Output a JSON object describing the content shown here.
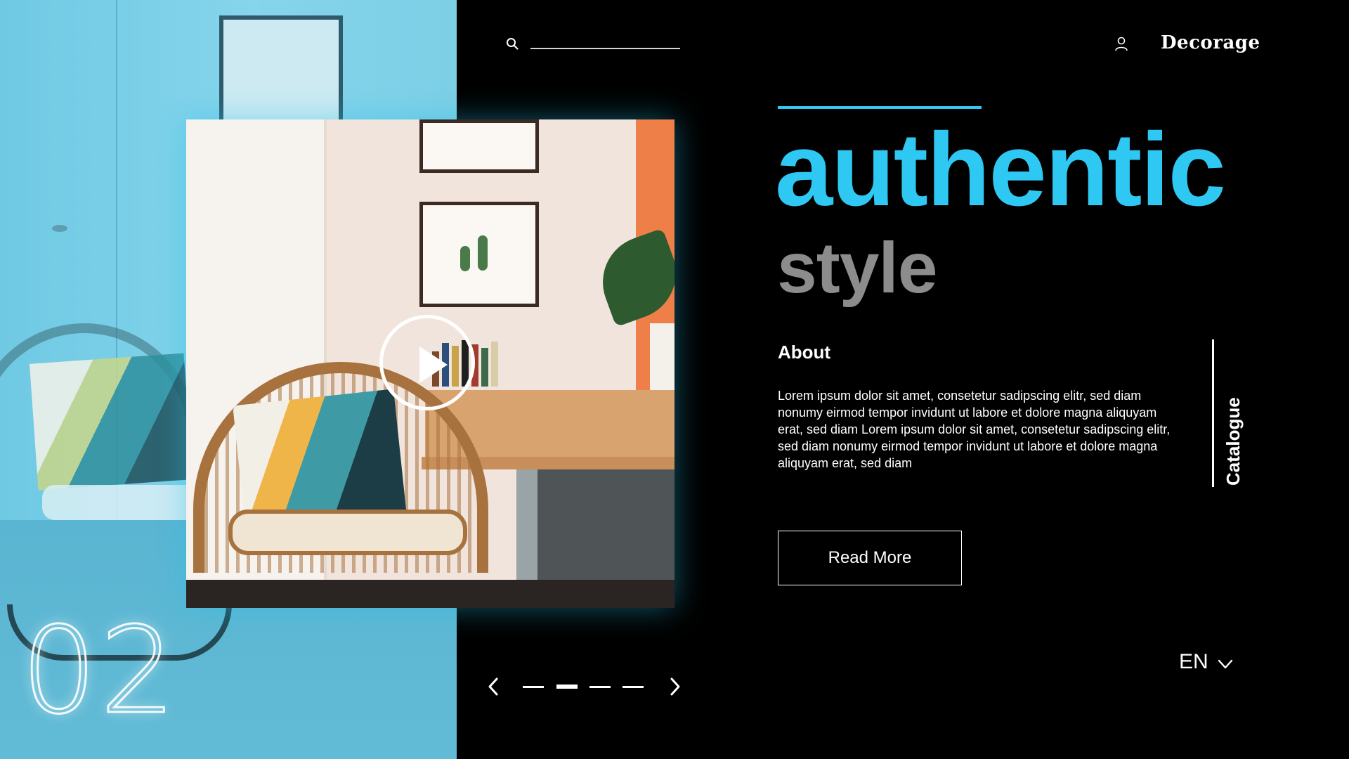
{
  "header": {
    "search_placeholder": "",
    "brand": "Decorage"
  },
  "hero": {
    "headline_primary": "authentic",
    "headline_secondary": "style"
  },
  "about": {
    "title": "About",
    "body": "Lorem ipsum dolor sit amet, consetetur sadipscing elitr, sed diam nonumy eirmod tempor invidunt ut labore et dolore magna aliquyam erat, sed diam Lorem ipsum dolor sit amet, consetetur sadipscing elitr, sed diam nonumy eirmod tempor invidunt ut labore et dolore magna aliquyam erat, sed diam",
    "cta": "Read More"
  },
  "side_nav": {
    "label": "Catalogue"
  },
  "slider": {
    "number": "02",
    "total_slides": 4,
    "active_slide": 2
  },
  "language": {
    "selected": "EN"
  },
  "icons": {
    "search": "search-icon",
    "user": "user-icon",
    "play": "play-icon",
    "prev": "chevron-left-icon",
    "next": "chevron-right-icon",
    "dropdown": "chevron-down-icon"
  },
  "colors": {
    "accent": "#2ec8f2",
    "secondary_text": "#8c8c8c",
    "background": "#000000"
  }
}
